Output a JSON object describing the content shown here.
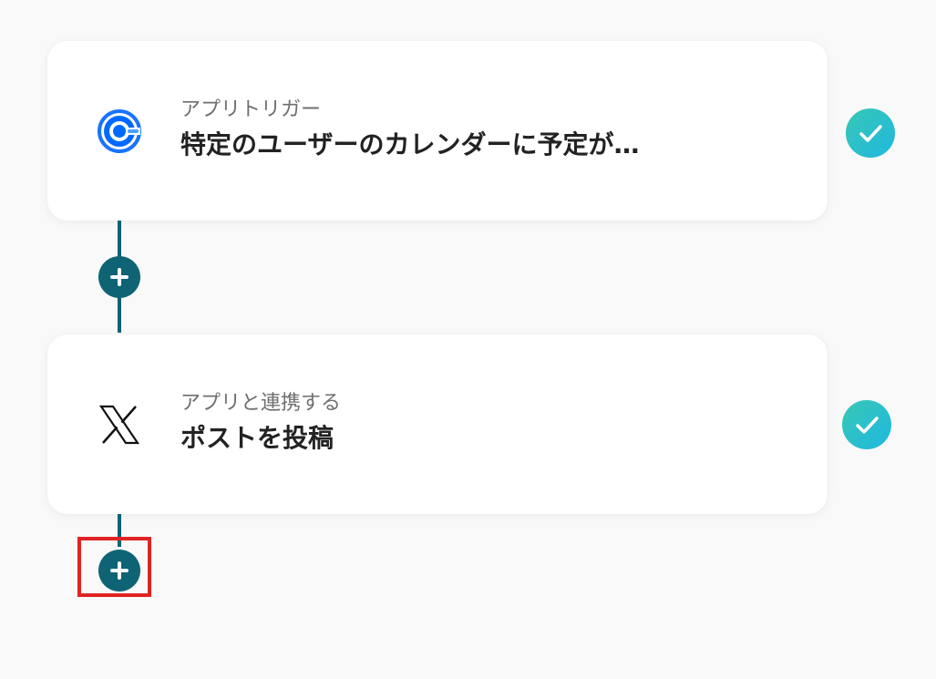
{
  "flow": {
    "steps": [
      {
        "label": "アプリトリガー",
        "title": "特定のユーザーのカレンダーに予定が…",
        "icon": "calendly-icon",
        "status": "completed"
      },
      {
        "label": "アプリと連携する",
        "title": "ポストを投稿",
        "icon": "x-logo-icon",
        "status": "completed"
      }
    ],
    "add_step_icon": "plus-icon",
    "highlighted_element": "add-step-button-2"
  },
  "colors": {
    "background": "#f9f9f9",
    "card": "#ffffff",
    "connector": "#0e6374",
    "check_gradient_start": "#38c7b5",
    "check_gradient_end": "#1fb8e0",
    "calendly_blue": "#0069ff",
    "highlight": "#e02424"
  }
}
